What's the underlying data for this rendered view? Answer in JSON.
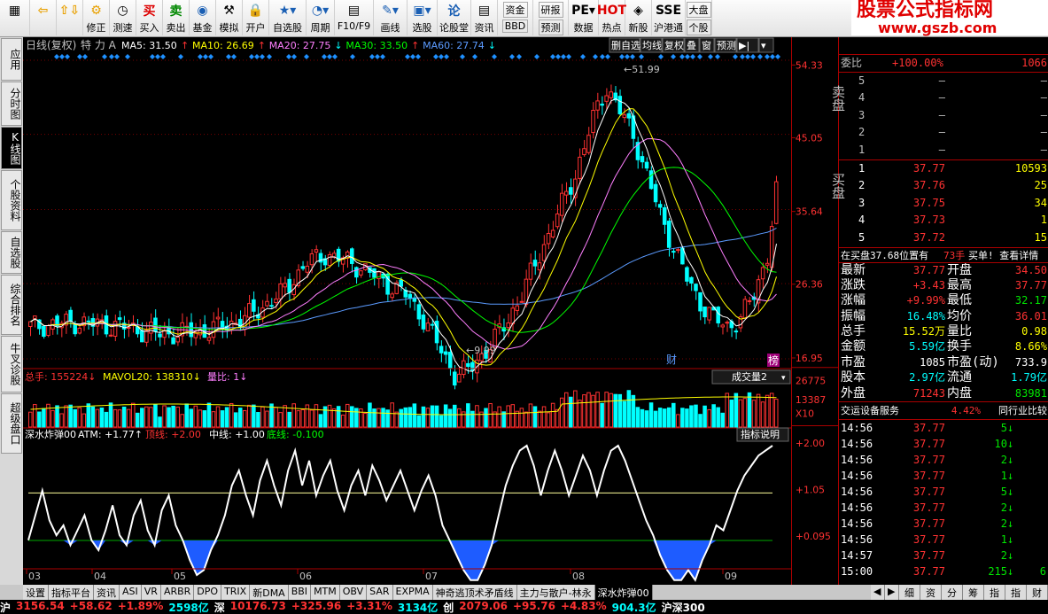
{
  "toolbar": {
    "items": [
      {
        "name": "menu",
        "label": "",
        "icon": "▦"
      },
      {
        "name": "back",
        "label": "",
        "icon": "⇦"
      },
      {
        "name": "nav",
        "label": "",
        "icon": "⇧⇩"
      },
      {
        "name": "modify",
        "label": "修正",
        "icon": "⚙"
      },
      {
        "name": "test",
        "label": "测速",
        "icon": "◷"
      },
      {
        "name": "buy",
        "label": "买入",
        "icon": "买"
      },
      {
        "name": "sell",
        "label": "卖出",
        "icon": "卖"
      },
      {
        "name": "fund",
        "label": "基金",
        "icon": "◉"
      },
      {
        "name": "simulate",
        "label": "模拟",
        "icon": "⚒"
      },
      {
        "name": "open",
        "label": "开户",
        "icon": "🔒"
      },
      {
        "name": "selfselect",
        "label": "自选股",
        "icon": "★▾"
      },
      {
        "name": "period",
        "label": "周期",
        "icon": "◔▾"
      },
      {
        "name": "f10",
        "label": "F10/F9",
        "icon": "▤"
      },
      {
        "name": "draw",
        "label": "画线",
        "icon": "✎▾"
      },
      {
        "name": "select",
        "label": "选股",
        "icon": "▣▾"
      },
      {
        "name": "forum",
        "label": "论股堂",
        "icon": "论"
      },
      {
        "name": "info",
        "label": "资讯",
        "icon": "▤"
      },
      {
        "name": "capital",
        "label": "资金",
        "sub": "BBD"
      },
      {
        "name": "research",
        "label": "研报",
        "sub": "预测"
      },
      {
        "name": "data",
        "label": "数据",
        "icon": "PE▾"
      },
      {
        "name": "hot",
        "label": "热点",
        "icon": "HOT"
      },
      {
        "name": "newstock",
        "label": "新股",
        "icon": "◈"
      },
      {
        "name": "hkconnect",
        "label": "沪港通",
        "icon": "SSE"
      },
      {
        "name": "market",
        "label": "大盘",
        "sub": "个股"
      }
    ]
  },
  "brand": {
    "line1": "股票公式指标网",
    "line2": "www.gszb.com"
  },
  "left_tabs": [
    {
      "label": "应用",
      "active": false
    },
    {
      "label": "分时图",
      "active": false
    },
    {
      "label": "K线图",
      "active": true
    },
    {
      "label": "个股资料",
      "active": false
    },
    {
      "label": "自选股",
      "active": false
    },
    {
      "label": "综合排名",
      "active": false
    },
    {
      "label": "牛叉诊股",
      "active": false
    },
    {
      "label": "超级盘口",
      "active": false
    }
  ],
  "main_header": {
    "period": "日线(复权)",
    "special": "特 力 A",
    "ma": [
      {
        "label": "MA5: 31.50",
        "arrow": "↑",
        "color": "#ffffff"
      },
      {
        "label": "MA10: 26.69",
        "arrow": "↑",
        "color": "#ffff00"
      },
      {
        "label": "MA20: 27.75",
        "arrow": "↓",
        "color": "#ff7fff"
      },
      {
        "label": "MA30: 33.50",
        "arrow": "↑",
        "color": "#00ff00"
      },
      {
        "label": "MA60: 27.74",
        "arrow": "↓",
        "color": "#5b9bff"
      }
    ],
    "buttons": [
      "删自选",
      "均线",
      "复权",
      "叠",
      "窗",
      "预测",
      "▶|",
      "▾"
    ]
  },
  "price_axis": [
    "54.33",
    "45.05",
    "35.64",
    "26.36",
    "16.95"
  ],
  "annotations": {
    "high": "51.99",
    "low": "9.99",
    "cai": "财",
    "bang": "榜"
  },
  "volume": {
    "header_label": "总手: 155224",
    "mavol_label": "MAVOL20: 138310",
    "ratio_label": "量比: 1",
    "dropdown": "成交量2",
    "axis": [
      "26775",
      "13387",
      "X10"
    ]
  },
  "indicator": {
    "name": "深水炸弹00",
    "atm": "ATM: +1.77",
    "top": "顶线: +2.00",
    "mid": "中线: +1.00",
    "bottom": "底线: -0.100",
    "button": "指标说明",
    "axis": [
      "+2.00",
      "+1.05",
      "+0.095"
    ]
  },
  "x_axis": [
    "03",
    "04",
    "05",
    "06",
    "07",
    "08",
    "09"
  ],
  "panel": {
    "weibi_label": "委比",
    "weibi_value": "+100.00%",
    "weicha_value": "1066",
    "sell_label": "卖盘",
    "buy_label": "买盘",
    "sell": [
      {
        "n": "5",
        "p": "–",
        "v": "–"
      },
      {
        "n": "4",
        "p": "–",
        "v": "–"
      },
      {
        "n": "3",
        "p": "–",
        "v": "–"
      },
      {
        "n": "2",
        "p": "–",
        "v": "–"
      },
      {
        "n": "1",
        "p": "–",
        "v": "–"
      }
    ],
    "buy": [
      {
        "n": "1",
        "p": "37.77",
        "v": "10593"
      },
      {
        "n": "2",
        "p": "37.76",
        "v": "25"
      },
      {
        "n": "3",
        "p": "37.75",
        "v": "34"
      },
      {
        "n": "4",
        "p": "37.73",
        "v": "1"
      },
      {
        "n": "5",
        "p": "37.72",
        "v": "15"
      }
    ],
    "info_line": "在买盘37.68位置有",
    "info_hand": "73手",
    "info_buy": "买单! 查看详情",
    "quote": [
      {
        "l": "最新",
        "v": "37.77",
        "l2": "开盘",
        "v2": "34.50",
        "c": "red",
        "c2": "red"
      },
      {
        "l": "涨跌",
        "v": "+3.43",
        "l2": "最高",
        "v2": "37.77",
        "c": "red",
        "c2": "red"
      },
      {
        "l": "涨幅",
        "v": "+9.99%",
        "l2": "最低",
        "v2": "32.17",
        "c": "red",
        "c2": "green"
      },
      {
        "l": "振幅",
        "v": "16.48%",
        "l2": "均价",
        "v2": "36.01",
        "c": "cyan",
        "c2": "red"
      },
      {
        "l": "总手",
        "v": "15.52万",
        "l2": "量比",
        "v2": "0.98",
        "c": "yellow",
        "c2": "yellow"
      },
      {
        "l": "金额",
        "v": "5.59亿",
        "l2": "换手",
        "v2": "8.66%",
        "c": "cyan",
        "c2": "yellow"
      },
      {
        "l": "市盈",
        "v": "1085",
        "l2": "市盈(动)",
        "v2": "733.9",
        "c": "white",
        "c2": "white"
      },
      {
        "l": "股本",
        "v": "2.97亿",
        "l2": "流通",
        "v2": "1.79亿",
        "c": "cyan",
        "c2": "cyan"
      },
      {
        "l": "外盘",
        "v": "71243",
        "l2": "内盘",
        "v2": "83981",
        "c": "red",
        "c2": "green"
      }
    ],
    "industry": {
      "name": "交运设备服务",
      "change": "4.42%",
      "compare": "同行业比较"
    },
    "ticks": [
      {
        "t": "14:56",
        "p": "37.77",
        "v": "5",
        "d": "↓"
      },
      {
        "t": "14:56",
        "p": "37.77",
        "v": "10",
        "d": "↓"
      },
      {
        "t": "14:56",
        "p": "37.77",
        "v": "2",
        "d": "↓"
      },
      {
        "t": "14:56",
        "p": "37.77",
        "v": "1",
        "d": "↓"
      },
      {
        "t": "14:56",
        "p": "37.77",
        "v": "5",
        "d": "↓"
      },
      {
        "t": "14:56",
        "p": "37.77",
        "v": "2",
        "d": "↓"
      },
      {
        "t": "14:56",
        "p": "37.77",
        "v": "2",
        "d": "↓"
      },
      {
        "t": "14:56",
        "p": "37.77",
        "v": "1",
        "d": "↓"
      },
      {
        "t": "14:57",
        "p": "37.77",
        "v": "2",
        "d": "↓"
      },
      {
        "t": "15:00",
        "p": "37.77",
        "v": "215",
        "d": "↓",
        "extra": "6"
      }
    ],
    "bottom_tabs": [
      "细",
      "资",
      "分",
      "筹",
      "指",
      "指",
      "财"
    ]
  },
  "bottom_tabs": [
    {
      "label": "设置",
      "active": false
    },
    {
      "label": "指标平台",
      "active": false
    },
    {
      "label": "资讯",
      "active": false
    },
    {
      "label": "ASI",
      "active": false
    },
    {
      "label": "VR",
      "active": false
    },
    {
      "label": "ARBR",
      "active": false
    },
    {
      "label": "DPO",
      "active": false
    },
    {
      "label": "TRIX",
      "active": false
    },
    {
      "label": "新DMA",
      "active": false
    },
    {
      "label": "BBI",
      "active": false
    },
    {
      "label": "MTM",
      "active": false
    },
    {
      "label": "OBV",
      "active": false
    },
    {
      "label": "SAR",
      "active": false
    },
    {
      "label": "EXPMA",
      "active": false
    },
    {
      "label": "神奇逃顶术矛盾线",
      "active": false
    },
    {
      "label": "主力与散户-林永",
      "active": false
    },
    {
      "label": "深水炸弹00",
      "active": true
    }
  ],
  "status": [
    {
      "t": "沪",
      "c": "white"
    },
    {
      "t": "3156.54",
      "c": "red"
    },
    {
      "t": "+58.62",
      "c": "red"
    },
    {
      "t": "+1.89%",
      "c": "red"
    },
    {
      "t": "2598亿",
      "c": "cyan"
    },
    {
      "t": "深",
      "c": "white"
    },
    {
      "t": "10176.73",
      "c": "red"
    },
    {
      "t": "+325.96",
      "c": "red"
    },
    {
      "t": "+3.31%",
      "c": "red"
    },
    {
      "t": "3134亿",
      "c": "cyan"
    },
    {
      "t": "创",
      "c": "white"
    },
    {
      "t": "2079.06",
      "c": "red"
    },
    {
      "t": "+95.76",
      "c": "red"
    },
    {
      "t": "+4.83%",
      "c": "red"
    },
    {
      "t": "904.3亿",
      "c": "cyan"
    },
    {
      "t": "沪深300",
      "c": "white"
    }
  ],
  "colors": {
    "up": "#ff3232",
    "down": "#00ffff",
    "ma5": "#ffffff",
    "ma10": "#ffff00",
    "ma20": "#ff7fff",
    "ma30": "#00ff00",
    "ma60": "#5b9bff",
    "indicator_fill": "#1e5cff"
  }
}
